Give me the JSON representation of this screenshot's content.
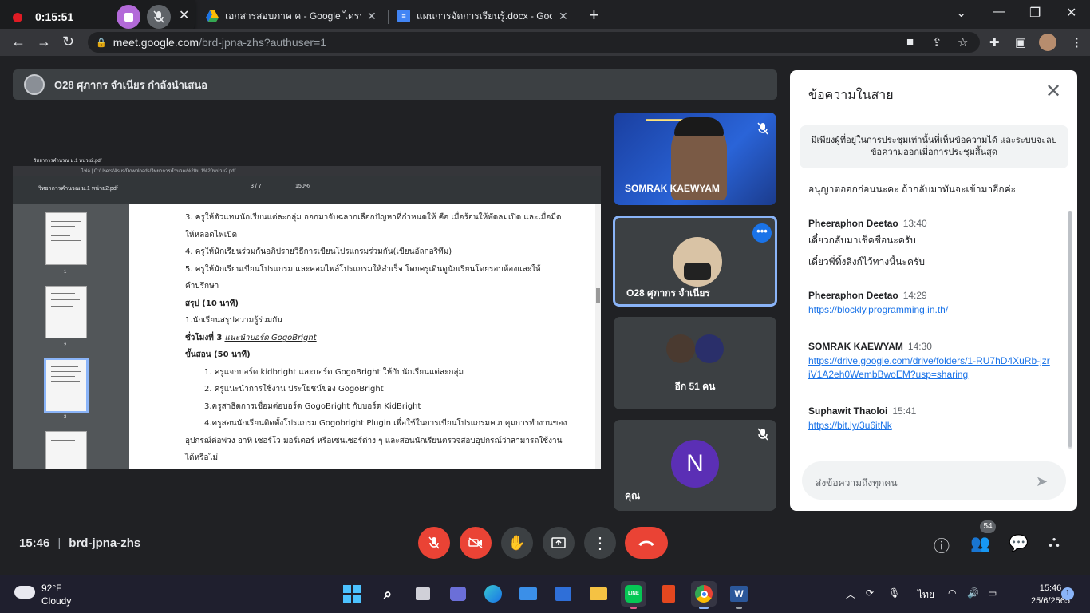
{
  "recorder": {
    "time": "0:15:51"
  },
  "browser": {
    "tabs": [
      {
        "title": "เอกสารสอบภาค ค - Google ไดรฟ์",
        "icon": "google-drive-icon"
      },
      {
        "title": "แผนการจัดการเรียนรู้.docx - Google",
        "icon": "google-docs-icon"
      }
    ],
    "url_host": "meet.google.com",
    "url_path": "/brd-jpna-zhs?authuser=1"
  },
  "presenter_bar": {
    "text": "O28 ศุภากร จำเนียร กำลังนำเสนอ"
  },
  "shared_screen": {
    "tab_title": "วิทยาการคำนวณ ม.1 หน่วย2.pdf",
    "address": "ไฟล์ | C:/Users/Asus/Downloads/วิทยาการคำนวณ%20ม.1%20หน่วย2.pdf",
    "file_name": "วิทยาการคำนวณ ม.1 หน่วย2.pdf",
    "page_indicator": "3 / 7",
    "zoom": "150%",
    "thumb_labels": [
      "1",
      "2",
      "3"
    ],
    "lines": [
      "3. ครูให้ตัวแทนนักเรียนแต่ละกลุ่ม ออกมาจับฉลากเลือกปัญหาที่กำหนดให้ คือ เมื่อร้อนให้พัดลมเปิด และเมื่อมืด",
      "ให้หลอดไฟเปิด",
      "4. ครูให้นักเรียนร่วมกันอภิปรายวิธีการเขียนโปรแกรมร่วมกัน(เขียนอัลกอริทึม)",
      "5. ครูให้นักเรียนเขียนโปรแกรม และคอมไพล์โปรแกรมให้สำเร็จ โดยครูเดินดูนักเรียนโดยรอบห้องและให้",
      "คำปรึกษา",
      "สรุป (10 นาที)",
      "1.นักเรียนสรุปความรู้ร่วมกัน",
      "ชั่วโมงที่ 3",
      "แนะนำบอร์ด GogoBright",
      "ขั้นสอน (50 นาที)",
      "1. ครูแจกบอร์ด kidbright และบอร์ด GogoBright ให้กับนักเรียนแต่ละกลุ่ม",
      "2. ครูแนะนำการใช้งาน ประโยชน์ของ GogoBright",
      "3.ครูสาธิตการเชื่อมต่อบอร์ด GogoBright กับบอร์ด KidBright",
      "4.ครูสอนนักเรียนติดตั้งโปรแกรม Gogobright Plugin เพื่อใช้ในการเขียนโปรแกรมควบคุมการทำงานของ",
      "อุปกรณ์ต่อพ่วง อาทิ เซอร์โว มอร์เตอร์ หรือเซนเซอร์ต่าง ๆ และสอนนักเรียนตรวจสอบอุปกรณ์ว่าสามารถใช้งาน",
      "ได้หรือไม่"
    ]
  },
  "participants": {
    "tile1_name": "SOMRAK KAEWYAM",
    "tile2_name": "O28 ศุภากร จำเนียร",
    "tile3_count": "อีก 51 คน",
    "tile4_initial": "N",
    "tile4_name": "คุณ"
  },
  "chat": {
    "header": "ข้อความในสาย",
    "notice": "มีเพียงผู้ที่อยู่ในการประชุมเท่านั้นที่เห็นข้อความได้ และระบบจะลบข้อความออกเมื่อการประชุมสิ้นสุด",
    "first_line": "อนุญาตออกก่อนนะคะ ถ้ากลับมาทันจะเข้ามาอีกค่ะ",
    "messages": [
      {
        "sender": "Pheeraphon Deetao",
        "time": "13:40",
        "lines": [
          "เดี๋ยวกลับมาเช็คชื่อนะครับ",
          "เดี๋ยวพี่ทิ้งลิงก์ไว้ทางนี้นะครับ"
        ],
        "link": ""
      },
      {
        "sender": "Pheeraphon Deetao",
        "time": "14:29",
        "lines": [],
        "link": "https://blockly.programming.in.th/"
      },
      {
        "sender": "SOMRAK KAEWYAM",
        "time": "14:30",
        "lines": [],
        "link": "https://drive.google.com/drive/folders/1-RU7hD4XuRb-jzriV1A2eh0WembBwoEM?usp=sharing"
      },
      {
        "sender": "Suphawit Thaoloi",
        "time": "15:41",
        "lines": [],
        "link": "https://bit.ly/3u6itNk"
      }
    ],
    "input_placeholder": "ส่งข้อความถึงทุกคน"
  },
  "bottom": {
    "time": "15:46",
    "meeting_code": "brd-jpna-zhs",
    "participant_count": "54"
  },
  "taskbar": {
    "temperature": "92°F",
    "condition": "Cloudy",
    "language": "ไทย",
    "clock_time": "15:46",
    "clock_date": "25/6/2565",
    "notifications": "1",
    "line_label": "LINE"
  },
  "colors": {
    "accent": "#1a73e8",
    "end_call": "#ea4335",
    "tile_highlight": "#8ab4f8"
  }
}
